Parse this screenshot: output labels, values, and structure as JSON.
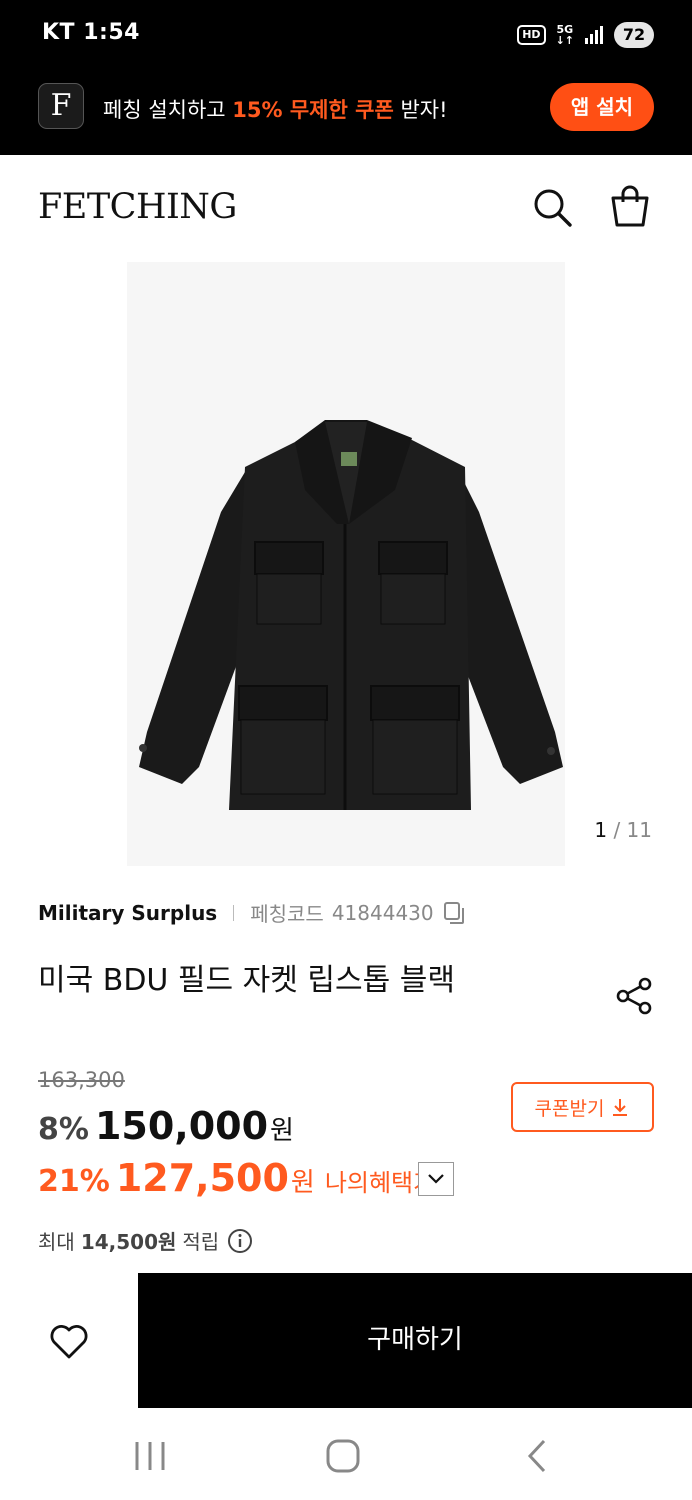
{
  "status_bar": {
    "carrier": "KT",
    "time": "1:54",
    "hd": "HD",
    "network": "5G",
    "battery": "72"
  },
  "promo": {
    "logo_letter": "F",
    "text_before": "페칭 설치하고 ",
    "text_highlight": "15% 무제한 쿠폰",
    "text_after": " 받자!",
    "install_label": "앱 설치",
    "accent_color": "#ff5a1f"
  },
  "header": {
    "brand": "FETCHING",
    "icons": [
      "search-icon",
      "shopping-bag-icon"
    ]
  },
  "gallery": {
    "current": "1",
    "separator": " / ",
    "total": "11"
  },
  "product": {
    "brand": "Military Surplus",
    "code_label": "페칭코드",
    "code": "41844430",
    "title": "미국 BDU 필드 자켓 립스톱 블랙",
    "original_price": "163,300",
    "discount_rate": "8%",
    "price": "150,000",
    "currency": "원",
    "benefit_rate": "21%",
    "benefit_price": "127,500",
    "benefit_label": "나의혜택가",
    "coupon_label": "쿠폰받기",
    "points_prefix": "최대",
    "points_amount": "14,500원",
    "points_suffix": "적립"
  },
  "actions": {
    "buy_label": "구매하기"
  }
}
